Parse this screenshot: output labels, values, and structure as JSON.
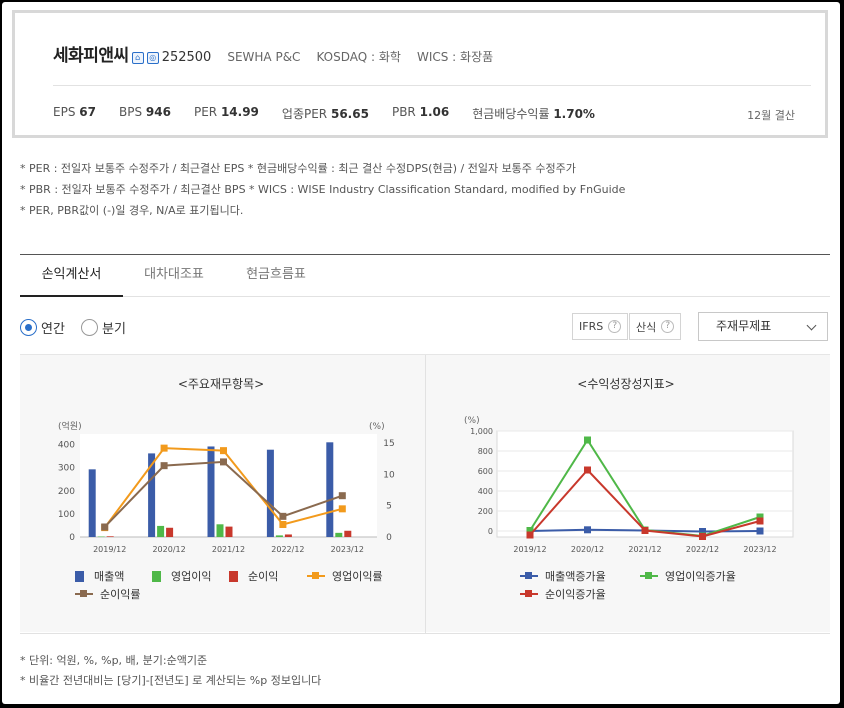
{
  "company": {
    "name": "세화피앤씨",
    "code": "252500",
    "eng_name": "SEWHA P&C",
    "market": "KOSDAQ : 화학",
    "wics": "WICS : 화장품",
    "icons": [
      "home-icon",
      "ir-icon"
    ]
  },
  "stats": [
    {
      "label": "EPS",
      "value": "67"
    },
    {
      "label": "BPS",
      "value": "946"
    },
    {
      "label": "PER",
      "value": "14.99"
    },
    {
      "label": "업종PER",
      "value": "56.65"
    },
    {
      "label": "PBR",
      "value": "1.06"
    },
    {
      "label": "현금배당수익률",
      "value": "1.70%"
    }
  ],
  "fiscal_note": "12월 결산",
  "notes": [
    "* PER : 전일자 보통주 수정주가 / 최근결산 EPS * 현금배당수익률 : 최근 결산 수정DPS(현금) / 전일자 보통주 수정주가",
    "* PBR : 전일자 보통주 수정주가 / 최근결산 BPS * WICS : WISE Industry Classification Standard, modified by FnGuide",
    "* PER, PBR값이 (-)일 경우, N/A로 표기됩니다."
  ],
  "tabs": [
    "손익계산서",
    "대차대조표",
    "현금흐름표"
  ],
  "period": {
    "annual": "연간",
    "quarterly": "분기",
    "selected": "annual"
  },
  "buttons": {
    "ifrs": "IFRS",
    "calc": "산식",
    "help": "?"
  },
  "select": {
    "value": "주재무제표"
  },
  "footnotes": [
    "* 단위: 억원, %, %p, 배, 분기:순액기준",
    "* 비율간 전년대비는 [당기]-[전년도] 로 계산되는 %p 정보입니다"
  ],
  "chart_data": [
    {
      "type": "bar",
      "title": "<주요재무항목>",
      "categories": [
        "2019/12",
        "2020/12",
        "2021/12",
        "2022/12",
        "2023/12"
      ],
      "ylabel": "(억원)",
      "y2label": "(%)",
      "ylim": [
        0,
        420
      ],
      "y_ticks": [
        "0",
        "100",
        "200",
        "300",
        "400"
      ],
      "y2lim": [
        0,
        15.5
      ],
      "y2_ticks": [
        "0",
        "5",
        "10",
        "15"
      ],
      "series": [
        {
          "name": "매출액",
          "kind": "bar",
          "axis": "left",
          "color": "#3b5ca8",
          "values": [
            293,
            362,
            392,
            378,
            410
          ]
        },
        {
          "name": "영업이익",
          "kind": "bar",
          "axis": "left",
          "color": "#4fb848",
          "values": [
            2,
            48,
            55,
            7,
            18
          ]
        },
        {
          "name": "순이익",
          "kind": "bar",
          "axis": "left",
          "color": "#c8382c",
          "values": [
            3,
            40,
            45,
            11,
            27
          ]
        },
        {
          "name": "영업이익률",
          "kind": "line",
          "axis": "right",
          "color": "#f29a1c",
          "values": [
            1.5,
            14.2,
            13.8,
            2.0,
            4.5
          ]
        },
        {
          "name": "순이익률",
          "kind": "line",
          "axis": "right",
          "color": "#8a6a4f",
          "values": [
            1.6,
            11.4,
            12.0,
            3.3,
            6.6
          ]
        }
      ]
    },
    {
      "type": "line",
      "title": "<수익성장성지표>",
      "categories": [
        "2019/12",
        "2020/12",
        "2021/12",
        "2022/12",
        "2023/12"
      ],
      "ylabel": "(%)",
      "ylim": [
        -60,
        1000
      ],
      "y_ticks": [
        "0",
        "200",
        "400",
        "600",
        "800",
        "1,000"
      ],
      "series": [
        {
          "name": "매출액증가율",
          "color": "#3b5ca8",
          "values": [
            0,
            12,
            5,
            -5,
            0
          ]
        },
        {
          "name": "영업이익증가율",
          "color": "#4fb848",
          "values": [
            5,
            910,
            10,
            -50,
            140
          ]
        },
        {
          "name": "순이익증가율",
          "color": "#c8382c",
          "values": [
            -40,
            610,
            5,
            -55,
            100
          ]
        }
      ]
    }
  ]
}
